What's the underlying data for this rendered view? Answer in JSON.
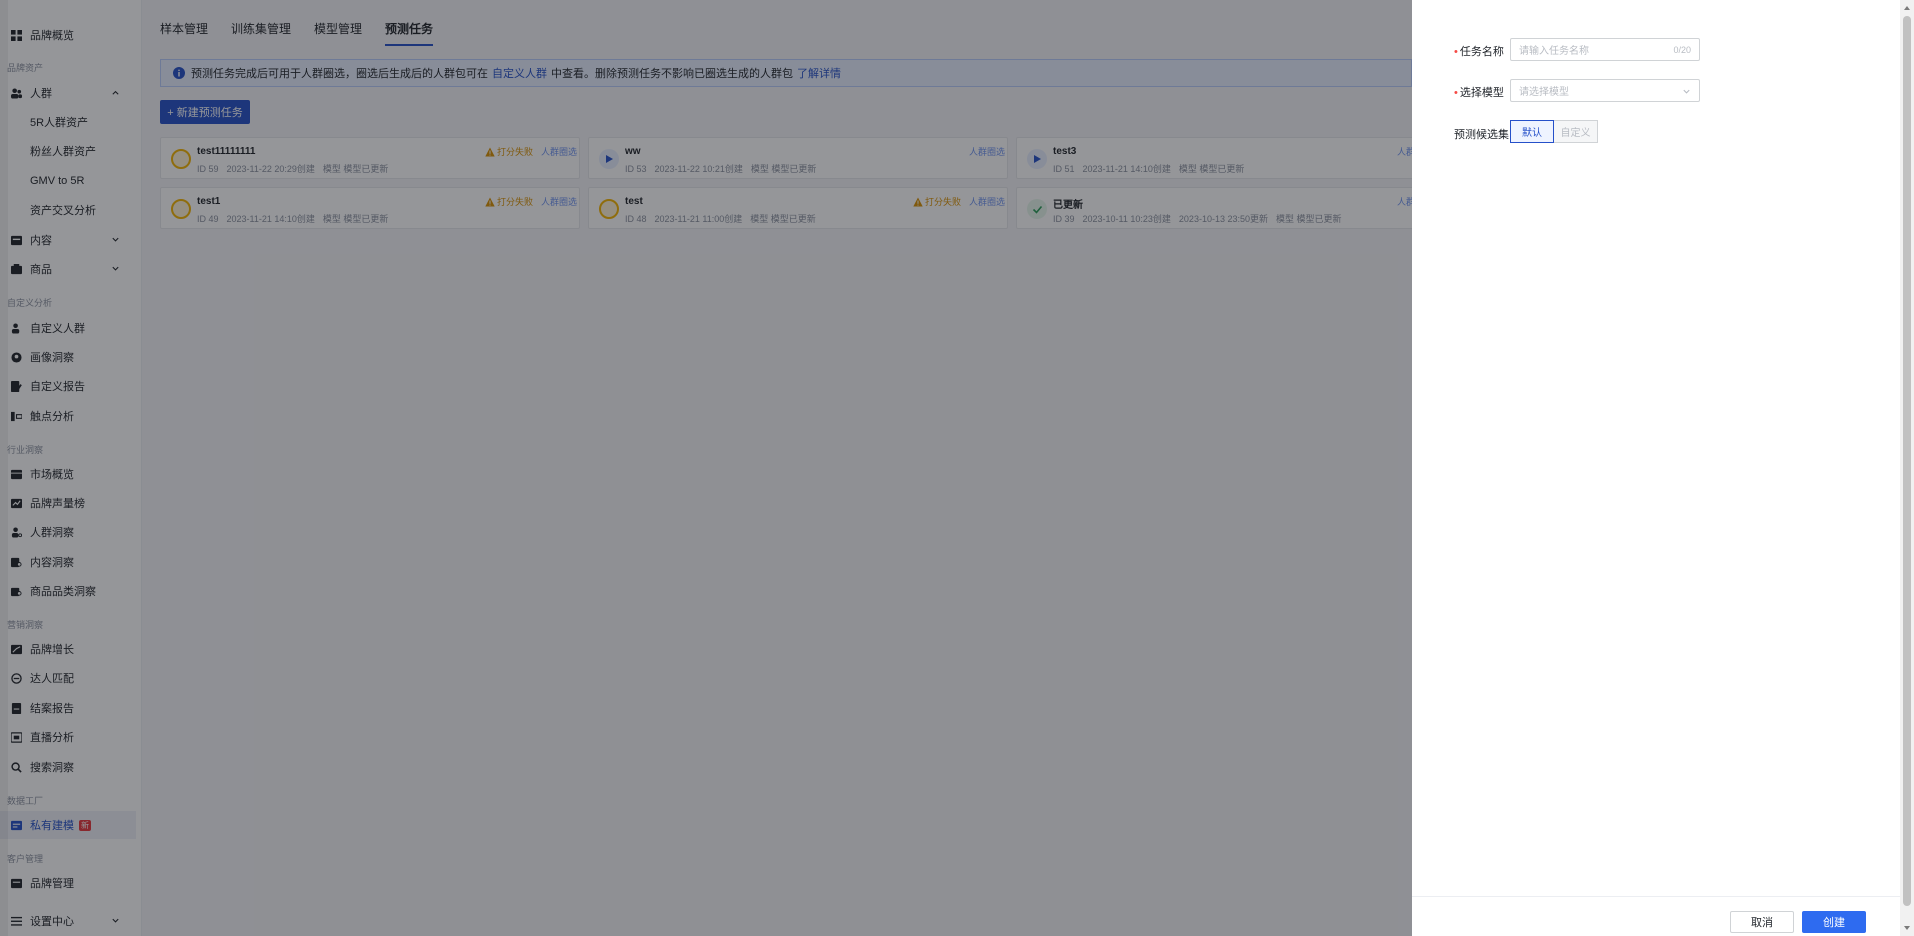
{
  "sidebar": {
    "top_item": "品牌概览",
    "group_brand_assets": "品牌资产",
    "crowd": "人群",
    "crowd_sub": [
      "5R人群资产",
      "粉丝人群资产",
      "GMV to 5R",
      "资产交叉分析"
    ],
    "content": "内容",
    "goods": "商品",
    "group_custom": "自定义分析",
    "custom_items": [
      "自定义人群",
      "画像洞察",
      "自定义报告",
      "触点分析"
    ],
    "group_industry": "行业洞察",
    "industry_items": [
      "市场概览",
      "品牌声量榜",
      "人群洞察",
      "内容洞察",
      "商品品类洞察"
    ],
    "group_marketing": "营销洞察",
    "marketing_items": [
      "品牌增长",
      "达人匹配",
      "结案报告",
      "直播分析",
      "搜索洞察"
    ],
    "group_data_factory": "数据工厂",
    "private_modeling": "私有建模",
    "new_badge": "新",
    "group_customer": "客户管理",
    "brand_mgmt": "品牌管理",
    "settings": "设置中心"
  },
  "tabs": [
    "样本管理",
    "训练集管理",
    "模型管理",
    "预测任务"
  ],
  "notice": {
    "text1": "预测任务完成后可用于人群圈选，圈选后生成后的人群包可在",
    "link1": "自定义人群",
    "text2": "中查看。删除预测任务不影响已圈选生成的人群包",
    "link2": "了解详情"
  },
  "new_task_button": "+ 新建预测任务",
  "cards": [
    {
      "title": "test11111111",
      "id": "ID 59",
      "created": "2023-11-22 20:29创建",
      "model": "模型 模型已更新",
      "warn": "打分失败",
      "link": "人群圈选",
      "state": "pending"
    },
    {
      "title": "ww",
      "id": "ID 53",
      "created": "2023-11-22 10:21创建",
      "model": "模型 模型已更新",
      "warn": "",
      "link": "人群圈选",
      "state": "playing"
    },
    {
      "title": "test3",
      "id": "ID 51",
      "created": "2023-11-21 14:10创建",
      "model": "模型 模型已更新",
      "warn": "",
      "link": "人群",
      "state": "playing"
    },
    {
      "title": "test1",
      "id": "ID 49",
      "created": "2023-11-21 14:10创建",
      "model": "模型 模型已更新",
      "warn": "打分失败",
      "link": "人群圈选",
      "state": "pending"
    },
    {
      "title": "test",
      "id": "ID 48",
      "created": "2023-11-21 11:00创建",
      "model": "模型 模型已更新",
      "warn": "打分失败",
      "link": "人群圈选",
      "state": "pending"
    },
    {
      "title": "已更新",
      "id": "ID 39",
      "created": "2023-10-11 10:23创建",
      "updated": "2023-10-13 23:50更新",
      "model": "模型 模型已更新",
      "warn": "",
      "link": "人群",
      "state": "done"
    }
  ],
  "drawer": {
    "task_name_label": "任务名称",
    "task_name_placeholder": "请输入任务名称",
    "task_name_count": "0/20",
    "model_label": "选择模型",
    "model_placeholder": "请选择模型",
    "candidate_label": "预测候选集",
    "seg_default": "默认",
    "seg_custom": "自定义",
    "cancel": "取消",
    "create": "创建"
  },
  "colors": {
    "accent": "#2550c9",
    "warning": "#d99100",
    "create_button": "#2e6bf0"
  }
}
